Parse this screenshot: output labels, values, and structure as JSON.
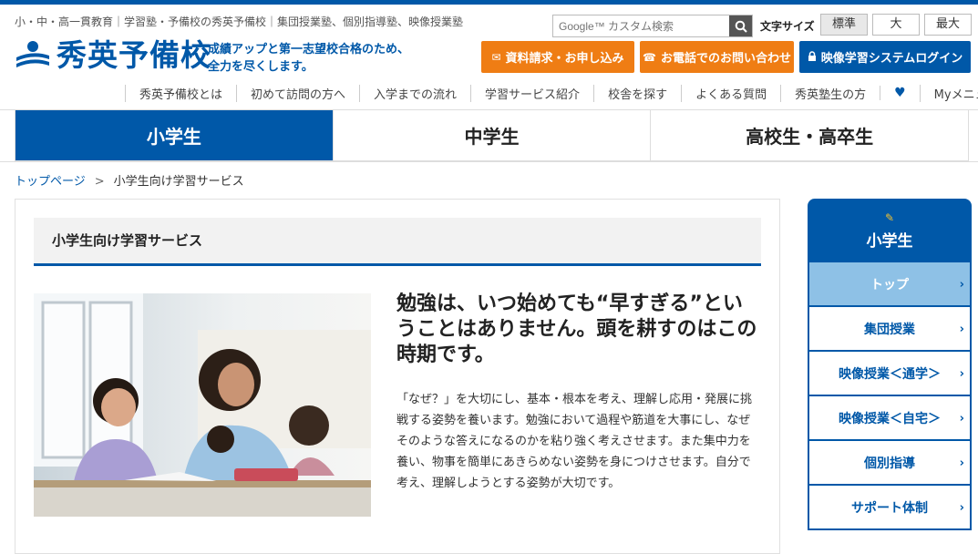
{
  "header": {
    "tagline": "小・中・高一貫教育｜学習塾・予備校の秀英予備校｜集団授業塾、個別指導塾、映像授業塾",
    "logo_text": "秀英予備校",
    "slogan": "成績アップと第一志望校合格のため、\n全力を尽くします。",
    "search": {
      "placeholder": "Google™ カスタム検索",
      "icon": "search-icon"
    },
    "font_size_label": "文字サイズ",
    "font_sizes": [
      "標準",
      "大",
      "最大"
    ],
    "cta": [
      {
        "label": "資料請求・お申し込み",
        "icon": "mail-icon",
        "color": "#ef7d14"
      },
      {
        "label": "お電話でのお問い合わせ",
        "icon": "phone-icon",
        "color": "#ef7d14"
      },
      {
        "label": "映像学習システムログイン",
        "icon": "lock-icon",
        "color": "#0058a8"
      }
    ],
    "subnav": [
      "秀英予備校とは",
      "初めて訪問の方へ",
      "入学までの流れ",
      "学習サービス紹介",
      "校舎を探す",
      "よくある質問",
      "秀英塾生の方",
      "♥",
      "Myメニュー"
    ]
  },
  "tabs": [
    {
      "label": "小学生"
    },
    {
      "label": "中学生"
    },
    {
      "label": "高校生・高卒生"
    }
  ],
  "breadcrumb": {
    "home": "トップページ",
    "sep": ">",
    "current": "小学生向け学習サービス"
  },
  "main": {
    "section_title": "小学生向け学習サービス",
    "headline": "勉強は、いつ始めても“早すぎる”ということはありません。頭を耕すのはこの時期です。",
    "body": "「なぜ？」を大切にし、基本・根本を考え、理解し応用・発展に挑戦する姿勢を養います。勉強において過程や筋道を大事にし、なぜそのような答えになるのかを粘り強く考えさせます。また集中力を養い、物事を簡単にあきらめない姿勢を身につけさせます。自分で考え、理解しようとする姿勢が大切です。"
  },
  "sidebar": {
    "title": "小学生",
    "items": [
      {
        "label": "トップ"
      },
      {
        "label": "集団授業"
      },
      {
        "label": "映像授業＜通学＞"
      },
      {
        "label": "映像授業＜自宅＞"
      },
      {
        "label": "個別指導"
      },
      {
        "label": "サポート体制"
      }
    ],
    "chevron": "›"
  },
  "colors": {
    "brand": "#0058a8",
    "accent": "#ef7d14",
    "side_active": "#8ec1e6"
  }
}
